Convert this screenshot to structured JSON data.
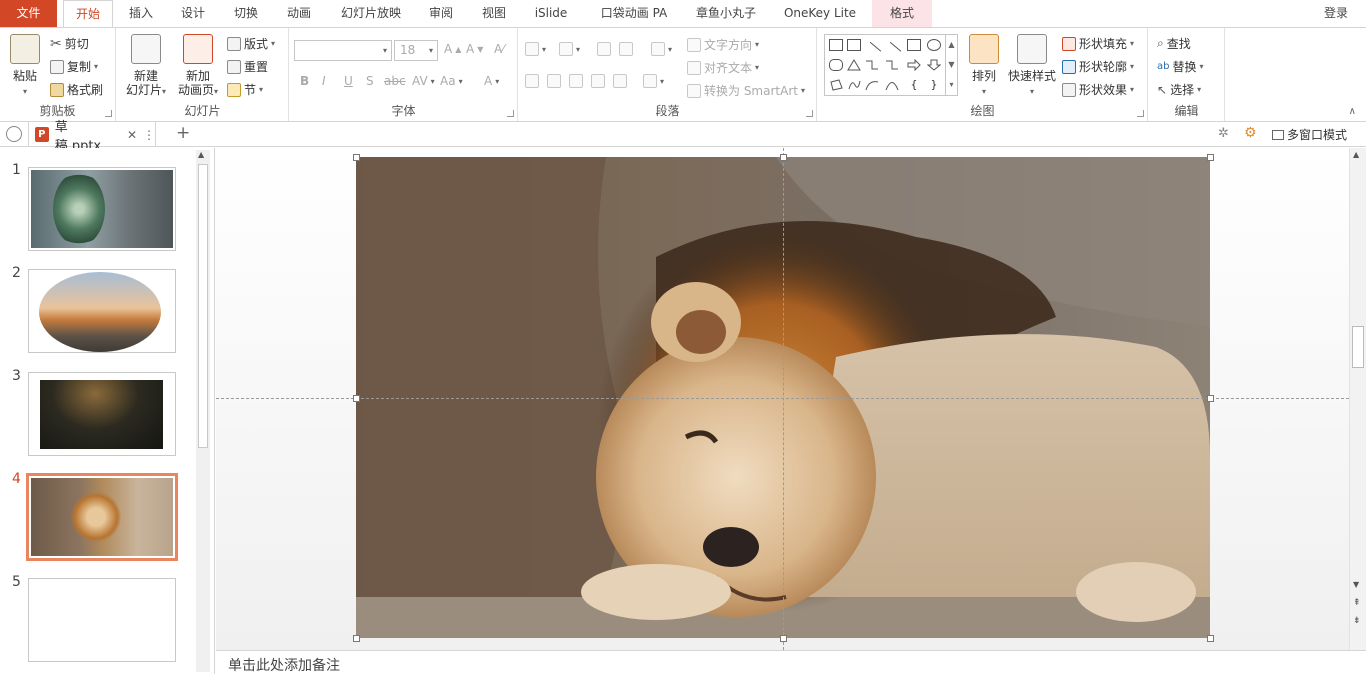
{
  "tabs": [
    "文件",
    "开始",
    "插入",
    "设计",
    "切换",
    "动画",
    "幻灯片放映",
    "审阅",
    "视图",
    "iSlide",
    "口袋动画 PA",
    "章鱼小丸子",
    "OneKey Lite",
    "格式"
  ],
  "login": "登录",
  "clipboard": {
    "paste": "粘贴",
    "cut": "剪切",
    "copy": "复制",
    "painter": "格式刷",
    "label": "剪贴板"
  },
  "slides_group": {
    "new_slide": "新建",
    "new_slide2": "幻灯片",
    "new_anim": "新加",
    "new_anim2": "动画页",
    "layout": "版式",
    "reset": "重置",
    "section": "节",
    "label": "幻灯片"
  },
  "font": {
    "size": "18",
    "label": "字体",
    "b": "B",
    "i": "I",
    "u": "U",
    "s": "S",
    "abc": "abc",
    "av": "AV",
    "aa": "Aa",
    "a": "A"
  },
  "paragraph": {
    "text_dir": "文字方向",
    "align_text": "对齐文本",
    "smartart": "转换为 SmartArt",
    "label": "段落"
  },
  "drawing": {
    "arrange": "排列",
    "quick_styles": "快速样式",
    "fill": "形状填充",
    "outline": "形状轮廓",
    "effects": "形状效果",
    "label": "绘图"
  },
  "editing": {
    "find": "查找",
    "replace": "替换",
    "select": "选择",
    "label": "编辑"
  },
  "doc": {
    "filename": "草稿.pptx",
    "multiwin": "多窗口模式",
    "ppt_letter": "P"
  },
  "slide_numbers": [
    "1",
    "2",
    "3",
    "4",
    "5"
  ],
  "selected_slide": 4,
  "notes_placeholder": "单击此处添加备注",
  "colors": {
    "accent": "#d24726",
    "format_tab": "#fbe3e8",
    "selected_thumb": "#e9855f"
  }
}
